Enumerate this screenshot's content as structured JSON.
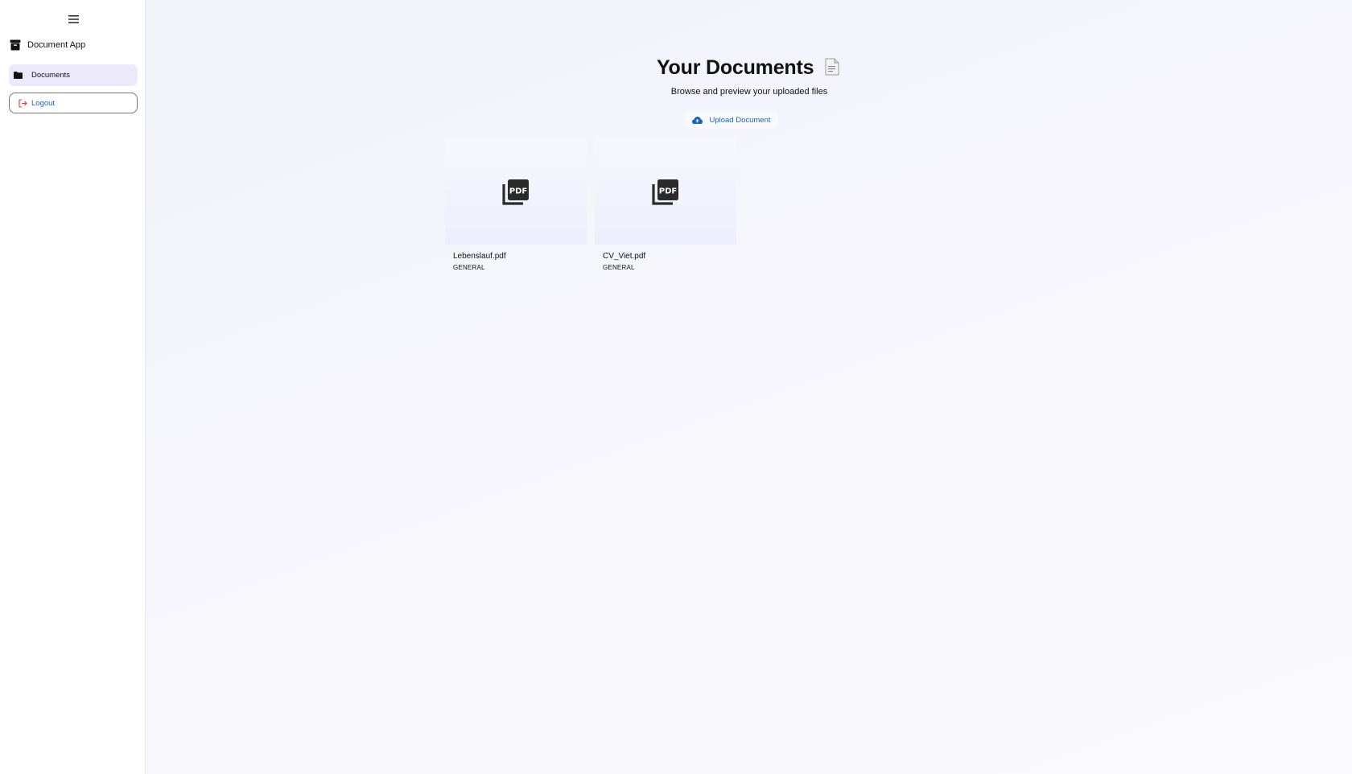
{
  "sidebar": {
    "menu_icon": "menu-icon",
    "brand": {
      "icon": "archive-icon",
      "title": "Document App"
    },
    "nav_items": [
      {
        "icon": "folder-icon",
        "label": "Documents",
        "active": true
      }
    ],
    "logout": {
      "icon": "logout-icon",
      "label": "Logout",
      "icon_color": "#e53935"
    }
  },
  "main": {
    "title": "Your Documents",
    "title_icon": "document-emoji-icon",
    "subtitle": "Browse and preview your uploaded files",
    "upload": {
      "icon": "cloud-upload-icon",
      "label": "Upload Document"
    },
    "documents": [
      {
        "name": "Lebenslauf.pdf",
        "category": "GENERAL",
        "icon": "pdf-icon"
      },
      {
        "name": "CV_Viet.pdf",
        "category": "GENERAL",
        "icon": "pdf-icon"
      }
    ]
  },
  "colors": {
    "accent": "#1565c0",
    "nav_active_bg": "#ece9fb",
    "logout_icon": "#e53935"
  }
}
